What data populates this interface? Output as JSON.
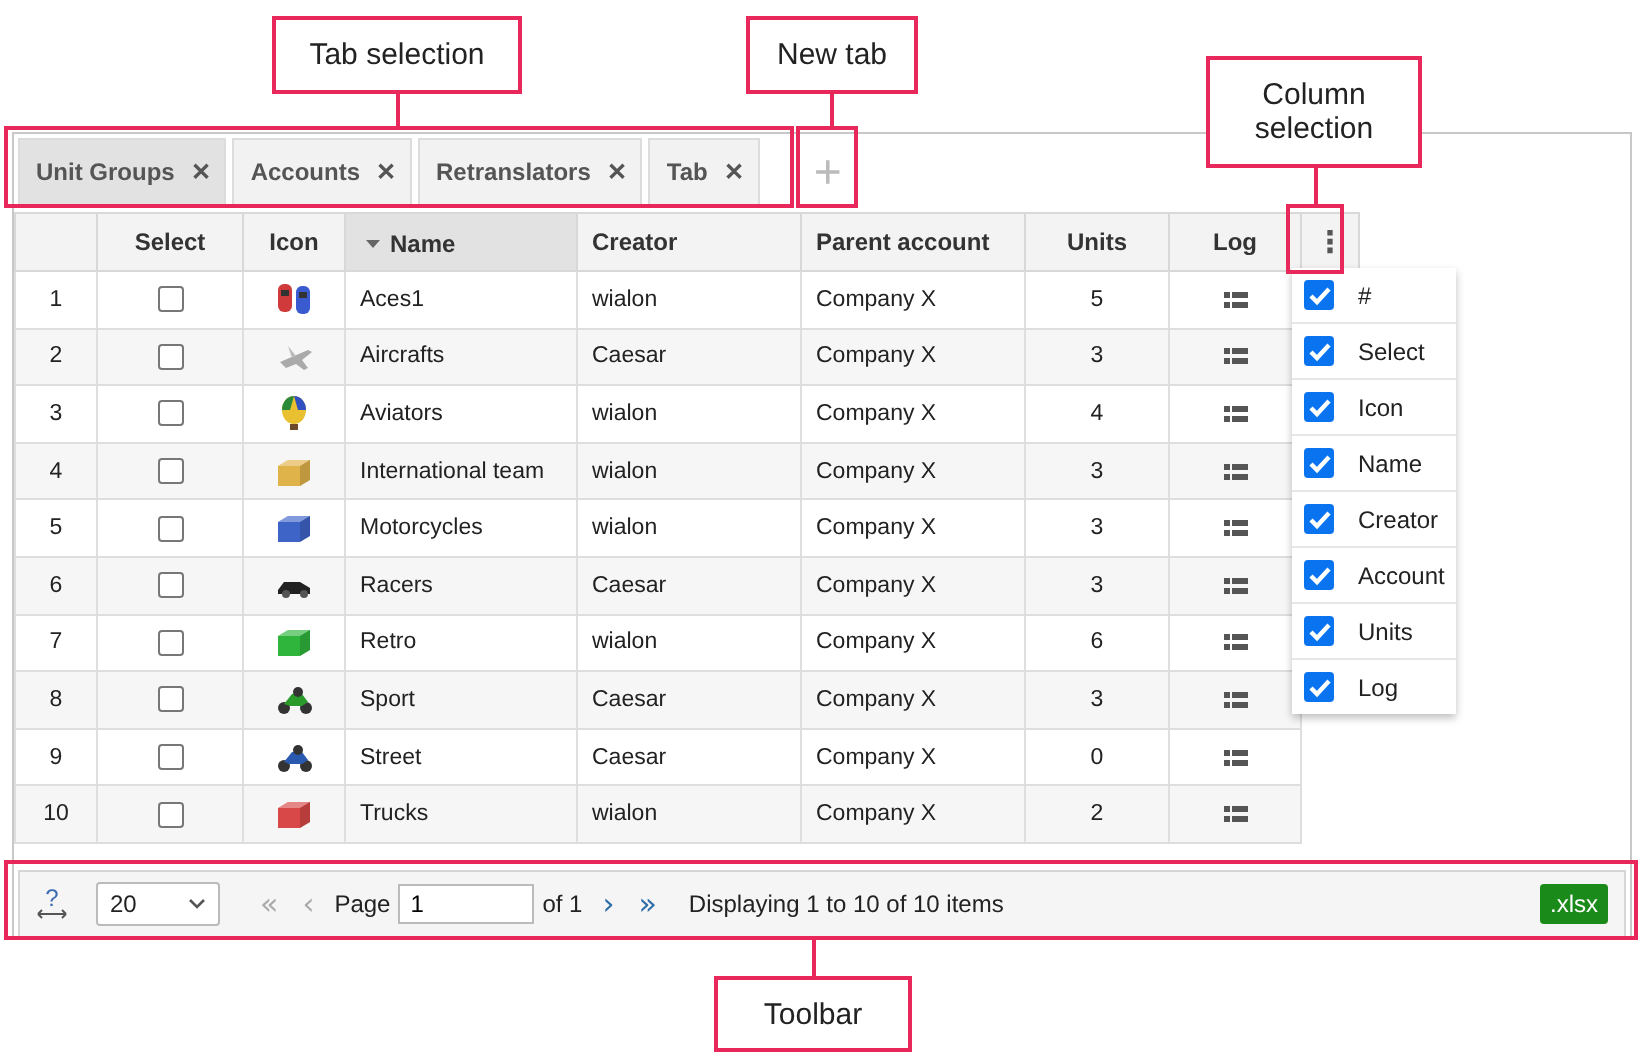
{
  "tabs": [
    {
      "label": "Unit Groups",
      "close": "✕",
      "selected": true
    },
    {
      "label": "Accounts",
      "close": "✕",
      "selected": false
    },
    {
      "label": "Retranslators",
      "close": "✕",
      "selected": false
    },
    {
      "label": "Tab",
      "close": "✕",
      "selected": false
    }
  ],
  "new_tab": "+",
  "table": {
    "columns": [
      {
        "sorted": false
      },
      {
        "label": "Select",
        "sorted": false
      },
      {
        "label": "Icon",
        "sorted": false
      },
      {
        "label": "Name",
        "sorted": true
      },
      {
        "label": "Creator",
        "sorted": false
      },
      {
        "label": "Parent account",
        "sorted": false
      },
      {
        "label": "Units",
        "sorted": false
      },
      {
        "label": "Log",
        "sorted": false
      }
    ],
    "menu_button": "⋮",
    "rows": [
      {
        "index": "1",
        "checked": false,
        "icon": {
          "kind": "cars"
        },
        "name": "Aces1",
        "creator": "wialon",
        "account": "Company X",
        "units": "5"
      },
      {
        "index": "2",
        "checked": false,
        "icon": {
          "kind": "plane"
        },
        "name": "Aircrafts",
        "creator": "Caesar",
        "account": "Company X",
        "units": "3"
      },
      {
        "index": "3",
        "checked": false,
        "icon": {
          "kind": "balloon"
        },
        "name": "Aviators",
        "creator": "wialon",
        "account": "Company X",
        "units": "4"
      },
      {
        "index": "4",
        "checked": false,
        "icon": {
          "kind": "container",
          "color": "#e0b24a"
        },
        "name": "International team",
        "creator": "wialon",
        "account": "Company X",
        "units": "3"
      },
      {
        "index": "5",
        "checked": false,
        "icon": {
          "kind": "container",
          "color": "#3e64c8"
        },
        "name": "Motorcycles",
        "creator": "wialon",
        "account": "Company X",
        "units": "3"
      },
      {
        "index": "6",
        "checked": false,
        "icon": {
          "kind": "car"
        },
        "name": "Racers",
        "creator": "Caesar",
        "account": "Company X",
        "units": "3"
      },
      {
        "index": "7",
        "checked": false,
        "icon": {
          "kind": "container",
          "color": "#2fb43c"
        },
        "name": "Retro",
        "creator": "wialon",
        "account": "Company X",
        "units": "6"
      },
      {
        "index": "8",
        "checked": false,
        "icon": {
          "kind": "motorbike",
          "color": "#2a9a2a"
        },
        "name": "Sport",
        "creator": "Caesar",
        "account": "Company X",
        "units": "3"
      },
      {
        "index": "9",
        "checked": false,
        "icon": {
          "kind": "motorbike",
          "color": "#2a5ab0"
        },
        "name": "Street",
        "creator": "Caesar",
        "account": "Company X",
        "units": "0"
      },
      {
        "index": "10",
        "checked": false,
        "icon": {
          "kind": "container",
          "color": "#d84848"
        },
        "name": "Trucks",
        "creator": "wialon",
        "account": "Company X",
        "units": "2"
      }
    ]
  },
  "column_menu": [
    {
      "label": "#",
      "checked": true
    },
    {
      "label": "Select",
      "checked": true
    },
    {
      "label": "Icon",
      "checked": true
    },
    {
      "label": "Name",
      "checked": true
    },
    {
      "label": "Creator",
      "checked": true
    },
    {
      "label": "Account",
      "checked": true
    },
    {
      "label": "Units",
      "checked": true
    },
    {
      "label": "Log",
      "checked": true
    }
  ],
  "toolbar": {
    "help": "?",
    "page_size": "20",
    "first": {
      "label": "«",
      "disabled": true
    },
    "prev": {
      "label": "‹",
      "disabled": true
    },
    "page_label": "Page",
    "page": "1",
    "of": "of 1",
    "next": {
      "label": "›",
      "disabled": false
    },
    "last": {
      "label": "»",
      "disabled": false
    },
    "display": "Displaying 1 to 10 of 10 items",
    "export": ".xlsx"
  },
  "callouts": [
    {
      "kind": "tabs",
      "label": "Tab selection"
    },
    {
      "kind": "new_tab",
      "label": "New tab"
    },
    {
      "kind": "column_menu",
      "label": "Column selection"
    },
    {
      "kind": "toolbar",
      "label": "Toolbar"
    }
  ]
}
